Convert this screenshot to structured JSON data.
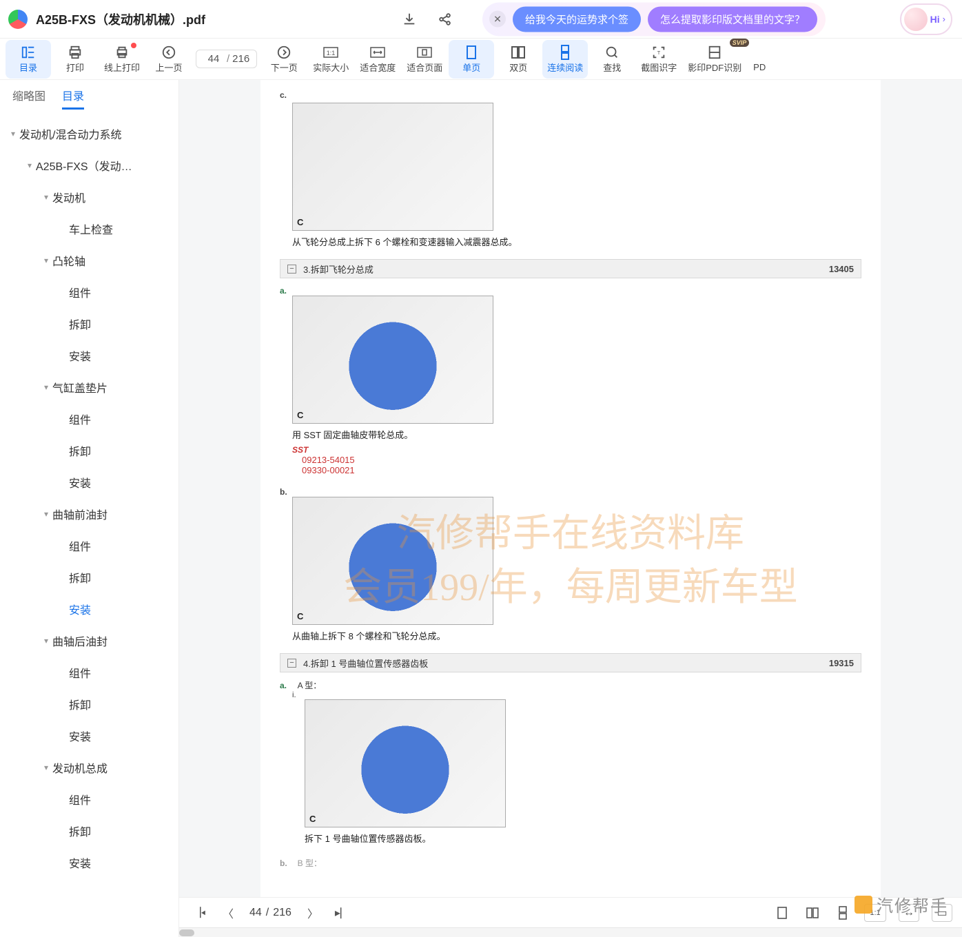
{
  "header": {
    "file_title": "A25B-FXS（发动机机械）.pdf",
    "ai_pill_1": "给我今天的运势求个签",
    "ai_pill_2": "怎么提取影印版文档里的文字？",
    "hi_label": "Hi"
  },
  "toolbar": {
    "toc": "目录",
    "print": "打印",
    "online_print": "线上打印",
    "prev_page": "上一页",
    "page_current": "44",
    "page_sep": "/",
    "page_total": "216",
    "next_page": "下一页",
    "actual_size": "实际大小",
    "fit_width": "适合宽度",
    "fit_page": "适合页面",
    "single_page": "单页",
    "two_page": "双页",
    "continuous": "连续阅读",
    "find": "查找",
    "ocr_capture": "截图识字",
    "scan_pdf_ocr": "影印PDF识别",
    "pdf_more": "PD"
  },
  "sidebar": {
    "tab_thumb": "缩略图",
    "tab_toc": "目录",
    "tree": [
      {
        "level": 0,
        "label": "发动机/混合动力系统",
        "chev": true
      },
      {
        "level": 1,
        "label": "A25B-FXS（发动…",
        "chev": true
      },
      {
        "level": 2,
        "label": "发动机",
        "chev": true
      },
      {
        "level": 3,
        "label": "车上检查"
      },
      {
        "level": 2,
        "label": "凸轮轴",
        "chev": true
      },
      {
        "level": 3,
        "label": "组件"
      },
      {
        "level": 3,
        "label": "拆卸"
      },
      {
        "level": 3,
        "label": "安装"
      },
      {
        "level": 2,
        "label": "气缸盖垫片",
        "chev": true
      },
      {
        "level": 3,
        "label": "组件"
      },
      {
        "level": 3,
        "label": "拆卸"
      },
      {
        "level": 3,
        "label": "安装"
      },
      {
        "level": 2,
        "label": "曲轴前油封",
        "chev": true
      },
      {
        "level": 3,
        "label": "组件"
      },
      {
        "level": 3,
        "label": "拆卸"
      },
      {
        "level": 3,
        "label": "安装",
        "current": true
      },
      {
        "level": 2,
        "label": "曲轴后油封",
        "chev": true
      },
      {
        "level": 3,
        "label": "组件"
      },
      {
        "level": 3,
        "label": "拆卸"
      },
      {
        "level": 3,
        "label": "安装"
      },
      {
        "level": 2,
        "label": "发动机总成",
        "chev": true
      },
      {
        "level": 3,
        "label": "组件"
      },
      {
        "level": 3,
        "label": "拆卸"
      },
      {
        "level": 3,
        "label": "安装"
      }
    ]
  },
  "doc": {
    "step_c": "c.",
    "fig_c": "C",
    "cap1": "从飞轮分总成上拆下 6 个螺栓和变速器输入减震器总成。",
    "sect3_title": "3.拆卸飞轮分总成",
    "sect3_code": "13405",
    "step_a": "a.",
    "sst_inline": "SST",
    "cap2": "用 SST 固定曲轴皮带轮总成。",
    "sst_title": "SST",
    "sst_num1": "09213-54015",
    "sst_num2": "09330-00021",
    "step_b": "b.",
    "cap3": "从曲轴上拆下 8 个螺栓和飞轮分总成。",
    "sect4_title": "4.拆卸 1 号曲轴位置传感器齿板",
    "sect4_code": "19315",
    "step_a2": "a.",
    "a_type": "A 型：",
    "step_i": "i.",
    "cap4": "拆下 1 号曲轴位置传感器齿板。",
    "step_b2": "b.",
    "b_type": "B 型：",
    "watermark_l1": "汽修帮手在线资料库",
    "watermark_l2": "会员199/年，每周更新车型",
    "brand": "汽修帮手"
  },
  "bottombar": {
    "page_current": "44",
    "page_sep": "/",
    "page_total": "216"
  }
}
